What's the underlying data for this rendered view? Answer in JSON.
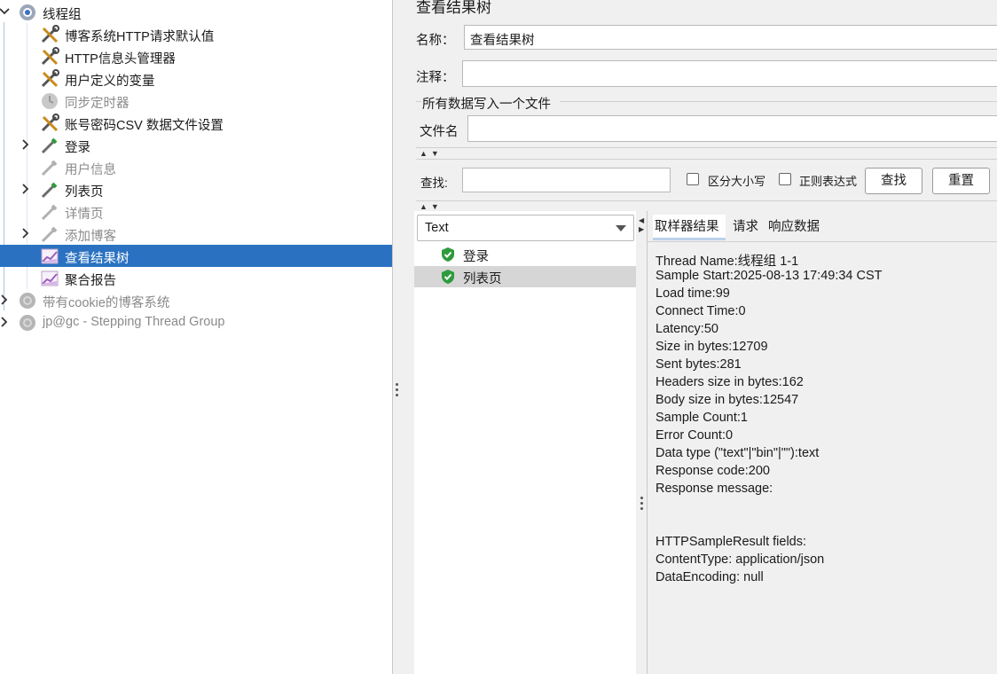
{
  "tree": {
    "items": [
      {
        "label": "线程组",
        "icon": "gear-icon",
        "state": "normal",
        "expander": "expanded"
      },
      {
        "label": "博客系统HTTP请求默认值",
        "icon": "wrench-screwdriver-icon",
        "state": "normal"
      },
      {
        "label": "HTTP信息头管理器",
        "icon": "wrench-screwdriver-icon",
        "state": "normal"
      },
      {
        "label": "用户定义的变量",
        "icon": "wrench-screwdriver-icon",
        "state": "normal"
      },
      {
        "label": "同步定时器",
        "icon": "timer-icon",
        "state": "disabled"
      },
      {
        "label": "账号密码CSV 数据文件设置",
        "icon": "wrench-screwdriver-icon",
        "state": "normal"
      },
      {
        "label": "登录",
        "icon": "pipette-icon",
        "state": "normal",
        "expander": "collapsed"
      },
      {
        "label": "用户信息",
        "icon": "pipette-icon",
        "state": "disabled"
      },
      {
        "label": "列表页",
        "icon": "pipette-icon",
        "state": "normal",
        "expander": "collapsed"
      },
      {
        "label": "详情页",
        "icon": "pipette-icon",
        "state": "disabled"
      },
      {
        "label": "添加博客",
        "icon": "pipette-icon",
        "state": "disabled",
        "expander": "collapsed"
      },
      {
        "label": "查看结果树",
        "icon": "chart-icon",
        "state": "selected"
      },
      {
        "label": "聚合报告",
        "icon": "chart-icon",
        "state": "normal"
      },
      {
        "label": "带有cookie的博客系统",
        "icon": "gear-icon",
        "state": "disabled",
        "expander": "collapsed"
      },
      {
        "label": "jp@gc - Stepping Thread Group",
        "icon": "gear-icon",
        "state": "disabled",
        "expander": "collapsed"
      }
    ]
  },
  "panel": {
    "title": "查看结果树",
    "name_label": "名称：",
    "name_value": "查看结果树",
    "comment_label": "注释：",
    "comment_value": "",
    "file_group_label": "所有数据写入一个文件",
    "filename_label": "文件名",
    "filename_value": "",
    "search_label": "查找:",
    "search_value": "",
    "case_sensitive_label": "区分大小写",
    "case_sensitive_checked": false,
    "regex_label": "正则表达式",
    "regex_checked": false,
    "find_button": "查找",
    "reset_button": "重置"
  },
  "results": {
    "renderer_selected": "Text",
    "samples": [
      {
        "label": "登录",
        "status": "success"
      },
      {
        "label": "列表页",
        "status": "success",
        "selected": true
      }
    ],
    "tabs": [
      "取样器结果",
      "请求",
      "响应数据"
    ],
    "active_tab": "取样器结果",
    "lines": [
      "Thread Name:线程组 1-1",
      "Sample Start:2025-08-13 17:49:34 CST",
      "Load time:99",
      "Connect Time:0",
      "Latency:50",
      "Size in bytes:12709",
      "Sent bytes:281",
      "Headers size in bytes:162",
      "Body size in bytes:12547",
      "Sample Count:1",
      "Error Count:0",
      "Data type (\"text\"|\"bin\"|\"\"):text",
      "Response code:200",
      "Response message:",
      "",
      "",
      "HTTPSampleResult fields:",
      "ContentType: application/json",
      "DataEncoding: null"
    ]
  },
  "colors": {
    "selection_bg": "#2a72c1",
    "success_green": "#2e9b3c",
    "panel_bg": "#f0f0f0"
  }
}
